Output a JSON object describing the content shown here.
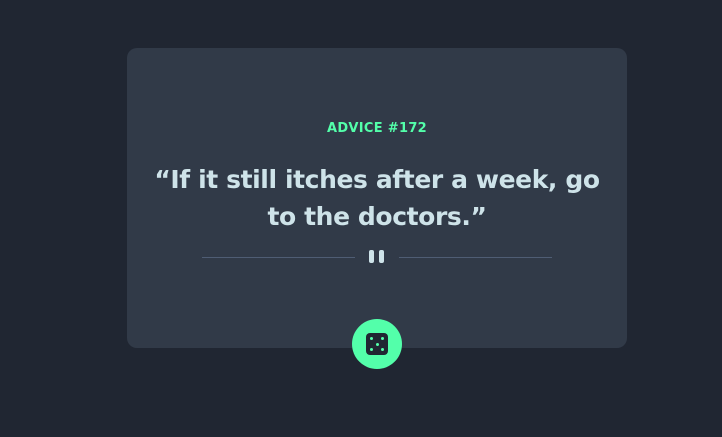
{
  "advice": {
    "id_label": "ADVICE #172",
    "text": "“If it still itches after a week, go to the doctors.”"
  },
  "icons": {
    "divider": "pause-icon",
    "button": "dice-icon"
  },
  "colors": {
    "background": "#202632",
    "card": "#313a48",
    "accent": "#53ffaa",
    "text": "#cee3e9",
    "divider": "#4f5d74"
  }
}
